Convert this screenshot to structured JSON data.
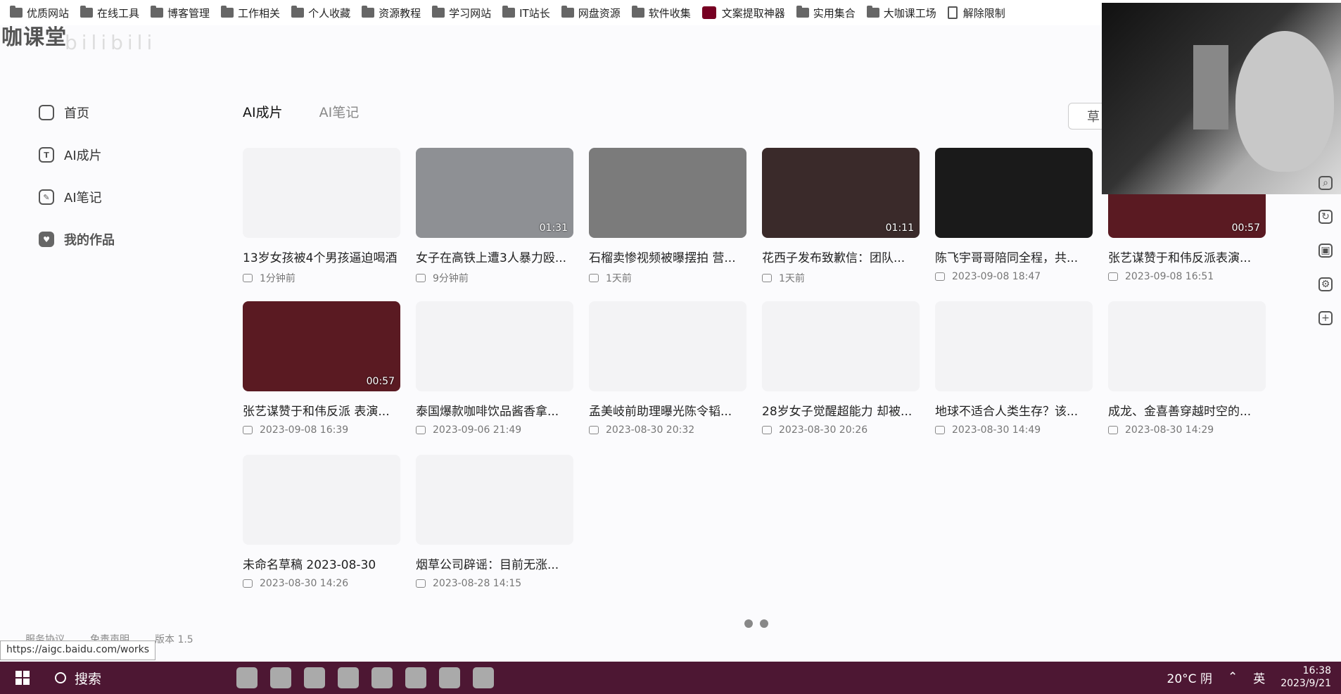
{
  "bookmarks": [
    "优质网站",
    "在线工具",
    "博客管理",
    "工作相关",
    "个人收藏",
    "资源教程",
    "学习网站",
    "IT站长",
    "网盘资源",
    "软件收集",
    "文案提取神器",
    "实用集合",
    "大咖课工场",
    "解除限制"
  ],
  "logo": "咖课堂",
  "watermark": "bilibili",
  "sidebar": {
    "items": [
      {
        "label": "首页",
        "icon": "home-icon",
        "glyph": ""
      },
      {
        "label": "AI成片",
        "icon": "ai-video-icon",
        "glyph": "T"
      },
      {
        "label": "AI笔记",
        "icon": "pen-icon",
        "glyph": "✎"
      },
      {
        "label": "我的作品",
        "icon": "works-icon",
        "glyph": "♥"
      }
    ]
  },
  "tabs": [
    "AI成片",
    "AI笔记"
  ],
  "draft_button": "草",
  "cards": [
    {
      "title": "13岁女孩被4个男孩逼迫喝酒",
      "time": "1分钟前",
      "duration": "",
      "thumb": "#f3f3f5"
    },
    {
      "title": "女子在高铁上遭3人暴力殴...",
      "time": "9分钟前",
      "duration": "01:31",
      "thumb": "#8e9094"
    },
    {
      "title": "石榴卖惨视频被曝摆拍 营...",
      "time": "1天前",
      "duration": "",
      "thumb": "#7b7b7b"
    },
    {
      "title": "花西子发布致歉信：团队...",
      "time": "1天前",
      "duration": "01:11",
      "thumb": "#3a2a2a"
    },
    {
      "title": "陈飞宇哥哥陪同全程，共...",
      "time": "2023-09-08 18:47",
      "duration": "",
      "thumb": "#1a1a1a"
    },
    {
      "title": "张艺谋赞于和伟反派表演...",
      "time": "2023-09-08 16:51",
      "duration": "00:57",
      "thumb": "#5a1a22"
    },
    {
      "title": "张艺谋赞于和伟反派 表演...",
      "time": "2023-09-08 16:39",
      "duration": "00:57",
      "thumb": "#5a1a22"
    },
    {
      "title": "泰国爆款咖啡饮品酱香拿...",
      "time": "2023-09-06 21:49",
      "duration": "",
      "thumb": "#f3f3f5"
    },
    {
      "title": "孟美岐前助理曝光陈令韬...",
      "time": "2023-08-30 20:32",
      "duration": "",
      "thumb": "#f3f3f5"
    },
    {
      "title": "28岁女子觉醒超能力 却被...",
      "time": "2023-08-30 20:26",
      "duration": "",
      "thumb": "#f3f3f5"
    },
    {
      "title": "地球不适合人类生存？该...",
      "time": "2023-08-30 14:49",
      "duration": "",
      "thumb": "#f3f3f5"
    },
    {
      "title": "成龙、金喜善穿越时空的...",
      "time": "2023-08-30 14:29",
      "duration": "",
      "thumb": "#f3f3f5"
    },
    {
      "title": "未命名草稿 2023-08-30",
      "time": "2023-08-30 14:26",
      "duration": "",
      "thumb": "#f3f3f5"
    },
    {
      "title": "烟草公司辟谣：目前无涨...",
      "time": "2023-08-28 14:15",
      "duration": "",
      "thumb": "#f3f3f5"
    }
  ],
  "footer": [
    "服务协议",
    "免责声明",
    "版本 1.5"
  ],
  "status_url": "https://aigc.baidu.com/works",
  "rightbar": [
    "search-icon",
    "refresh-icon",
    "gamepad-icon",
    "settings-icon",
    "plus-icon"
  ],
  "taskbar": {
    "search_label": "搜索",
    "weather": "20°C 阴",
    "ime": "英",
    "time": "16:38",
    "date": "2023/9/21"
  }
}
